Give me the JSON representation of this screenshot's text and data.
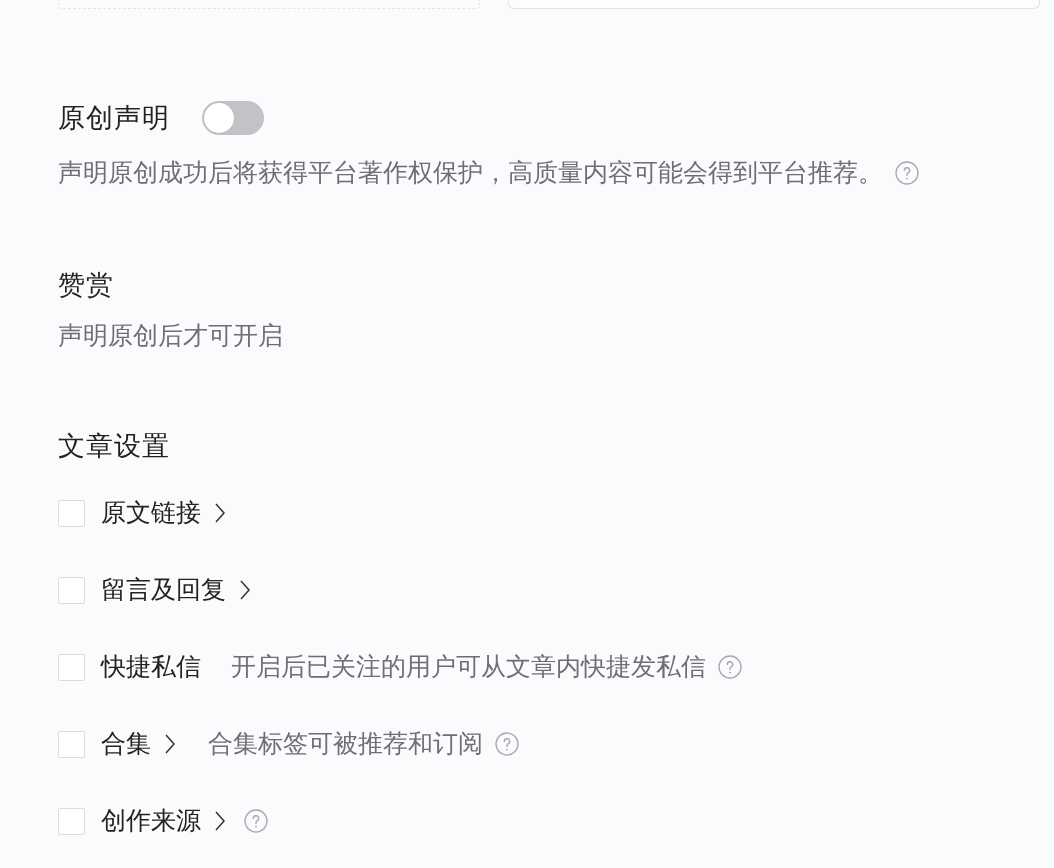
{
  "original_declaration": {
    "title": "原创声明",
    "on": false,
    "description": "声明原创成功后将获得平台著作权保护，高质量内容可能会得到平台推荐。",
    "help": true
  },
  "reward": {
    "title": "赞赏",
    "note": "声明原创后才可开启"
  },
  "article_settings": {
    "title": "文章设置",
    "options": [
      {
        "label": "原文链接",
        "checked": false,
        "chevron": true,
        "help": false
      },
      {
        "label": "留言及回复",
        "checked": false,
        "chevron": true,
        "help": false
      },
      {
        "label": "快捷私信",
        "checked": false,
        "chevron": false,
        "hint": "开启后已关注的用户可从文章内快捷发私信",
        "help": true
      },
      {
        "label": "合集",
        "checked": false,
        "chevron": true,
        "hint": "合集标签可被推荐和订阅",
        "help": true
      },
      {
        "label": "创作来源",
        "checked": false,
        "chevron": true,
        "help": true
      }
    ]
  }
}
